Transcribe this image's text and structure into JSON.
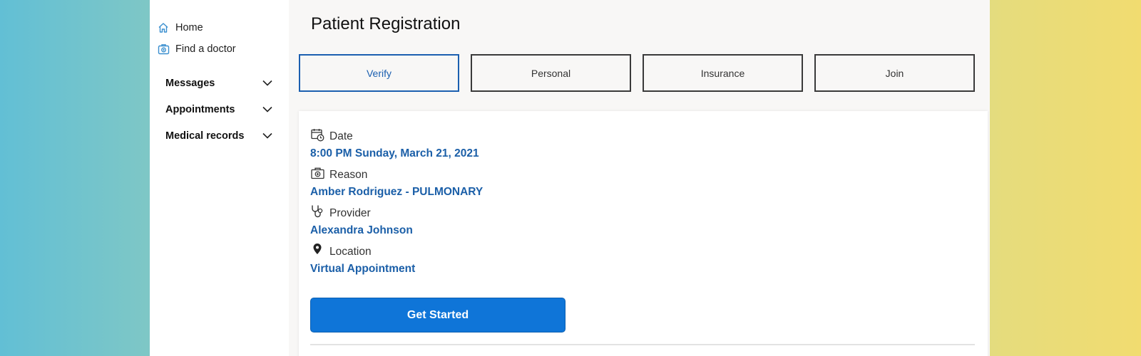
{
  "sidebar": {
    "links": [
      {
        "label": "Home",
        "icon": "home-icon"
      },
      {
        "label": "Find a doctor",
        "icon": "doctor-search-icon"
      }
    ],
    "groups": [
      {
        "label": "Messages",
        "icon": "chevron-down-icon"
      },
      {
        "label": "Appointments",
        "icon": "chevron-down-icon"
      },
      {
        "label": "Medical records",
        "icon": "chevron-down-icon"
      }
    ]
  },
  "page": {
    "title": "Patient Registration"
  },
  "steps": [
    {
      "label": "Verify",
      "active": true
    },
    {
      "label": "Personal",
      "active": false
    },
    {
      "label": "Insurance",
      "active": false
    },
    {
      "label": "Join",
      "active": false
    }
  ],
  "appointment": {
    "date": {
      "label": "Date",
      "value": "8:00 PM Sunday, March 21, 2021",
      "icon": "calendar-clock-icon"
    },
    "reason": {
      "label": "Reason",
      "value": "Amber Rodriguez - PULMONARY",
      "icon": "medical-bag-icon"
    },
    "provider": {
      "label": "Provider",
      "value": "Alexandra Johnson",
      "icon": "stethoscope-icon"
    },
    "location": {
      "label": "Location",
      "value": "Virtual Appointment",
      "icon": "map-pin-icon"
    }
  },
  "actions": {
    "get_started_label": "Get Started"
  },
  "colors": {
    "accent": "#1b5fa8",
    "primary_button": "#0f75d8",
    "active_step_border": "#1b5fb0"
  }
}
